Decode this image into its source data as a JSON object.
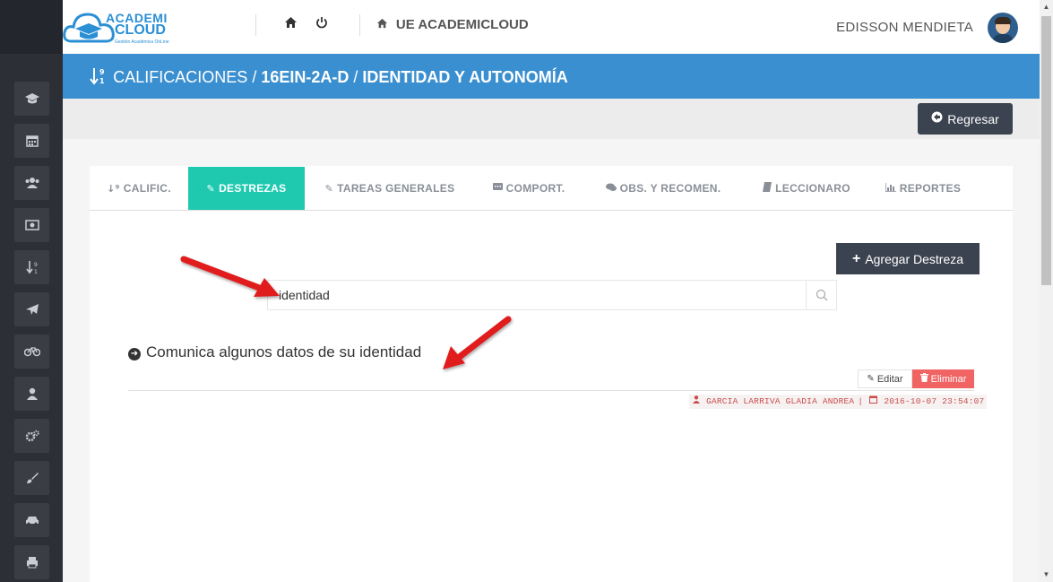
{
  "sidebar": {
    "items": [
      {
        "icon": "graduation-cap-icon",
        "glyph": "🎓"
      },
      {
        "icon": "calendar-icon",
        "glyph": "▦"
      },
      {
        "icon": "users-icon",
        "glyph": "👥"
      },
      {
        "icon": "money-icon",
        "glyph": "▣"
      },
      {
        "icon": "sort-numeric-icon",
        "glyph": "↓"
      },
      {
        "icon": "paper-plane-icon",
        "glyph": "➤"
      },
      {
        "icon": "bicycle-icon",
        "glyph": "⚲"
      },
      {
        "icon": "user-icon",
        "glyph": "👤"
      },
      {
        "icon": "cogs-icon",
        "glyph": "⚙"
      },
      {
        "icon": "paint-brush-icon",
        "glyph": "✎"
      },
      {
        "icon": "car-icon",
        "glyph": "🚗"
      },
      {
        "icon": "print-icon",
        "glyph": "⎙"
      }
    ]
  },
  "header": {
    "logo": {
      "line1": "ACADEMI",
      "line2": "CLOUD",
      "line3": "Gestión Académica OnLine"
    },
    "home_icon": "⌂",
    "power_icon": "⏻",
    "school_name": "UE ACADEMICLOUD",
    "user_name": "EDISSON MENDIETA"
  },
  "breadcrumb": {
    "icon": "↓⁹₁",
    "section": "CALIFICACIONES",
    "separator1": " / ",
    "course": "16EIN-2A-D",
    "separator2": " / ",
    "subject": "IDENTIDAD Y AUTONOMÍA"
  },
  "toolbar": {
    "back_label": "Regresar",
    "back_icon": "◀"
  },
  "tabs": [
    {
      "label": "CALIFIC.",
      "icon": "↓⁹",
      "active": false
    },
    {
      "label": "DESTREZAS",
      "icon": "✎",
      "active": true
    },
    {
      "label": "TAREAS GENERALES",
      "icon": "✎",
      "active": false
    },
    {
      "label": "COMPORT.",
      "icon": "▬",
      "active": false
    },
    {
      "label": "OBS. Y RECOMEN.",
      "icon": "●",
      "active": false
    },
    {
      "label": "LECCIONARO",
      "icon": "▮",
      "active": false
    },
    {
      "label": "REPORTES",
      "icon": "▥",
      "active": false
    }
  ],
  "add_button": {
    "label": "Agregar Destreza",
    "icon": "+"
  },
  "search": {
    "value": "identidad",
    "icon": "⚲"
  },
  "skill": {
    "title": "Comunica algunos datos de su identidad",
    "edit_label": "Editar",
    "delete_label": "Eliminar",
    "author": "GARCIA LARRIVA GLADIA ANDREA",
    "meta_separator": "|",
    "timestamp": "2016-10-07 23:54:07"
  },
  "colors": {
    "sidebar": "#2c2f36",
    "titlebar": "#3a8fd0",
    "active_tab": "#1fc9b0",
    "dark_button": "#3b4350",
    "danger": "#f06464",
    "arrow": "#e01b1b"
  }
}
